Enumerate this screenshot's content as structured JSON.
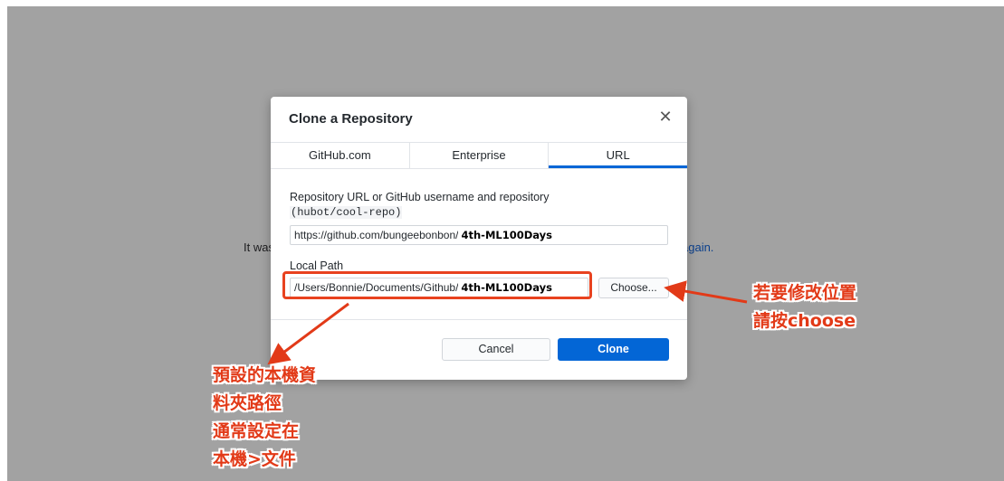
{
  "background": {
    "left_text": "It was",
    "right_text": "again."
  },
  "dialog": {
    "title": "Clone a Repository",
    "close_glyph": "✕",
    "tabs": [
      {
        "label": "GitHub.com",
        "active": false
      },
      {
        "label": "Enterprise",
        "active": false
      },
      {
        "label": "URL",
        "active": true
      }
    ],
    "repo_label": "Repository URL or GitHub username and repository",
    "repo_example": "(hubot/cool-repo)",
    "url_value_prefix": "https://github.com/bungeebonbon/",
    "url_value_suffix": "4th-ML100Days",
    "local_path_label": "Local Path",
    "path_value_prefix": "/Users/Bonnie/Documents/Github/",
    "path_value_suffix": "4th-ML100Days",
    "choose_label": "Choose...",
    "cancel_label": "Cancel",
    "clone_label": "Clone"
  },
  "annotations": {
    "right": [
      "若要修改位置",
      "請按choose"
    ],
    "left": [
      "預設的本機資",
      "料夾路徑",
      "通常設定在",
      "本機>文件"
    ]
  },
  "colors": {
    "accent": "#0366d6",
    "annotation": "#e23a18",
    "overlay": "#a2a2a2"
  }
}
